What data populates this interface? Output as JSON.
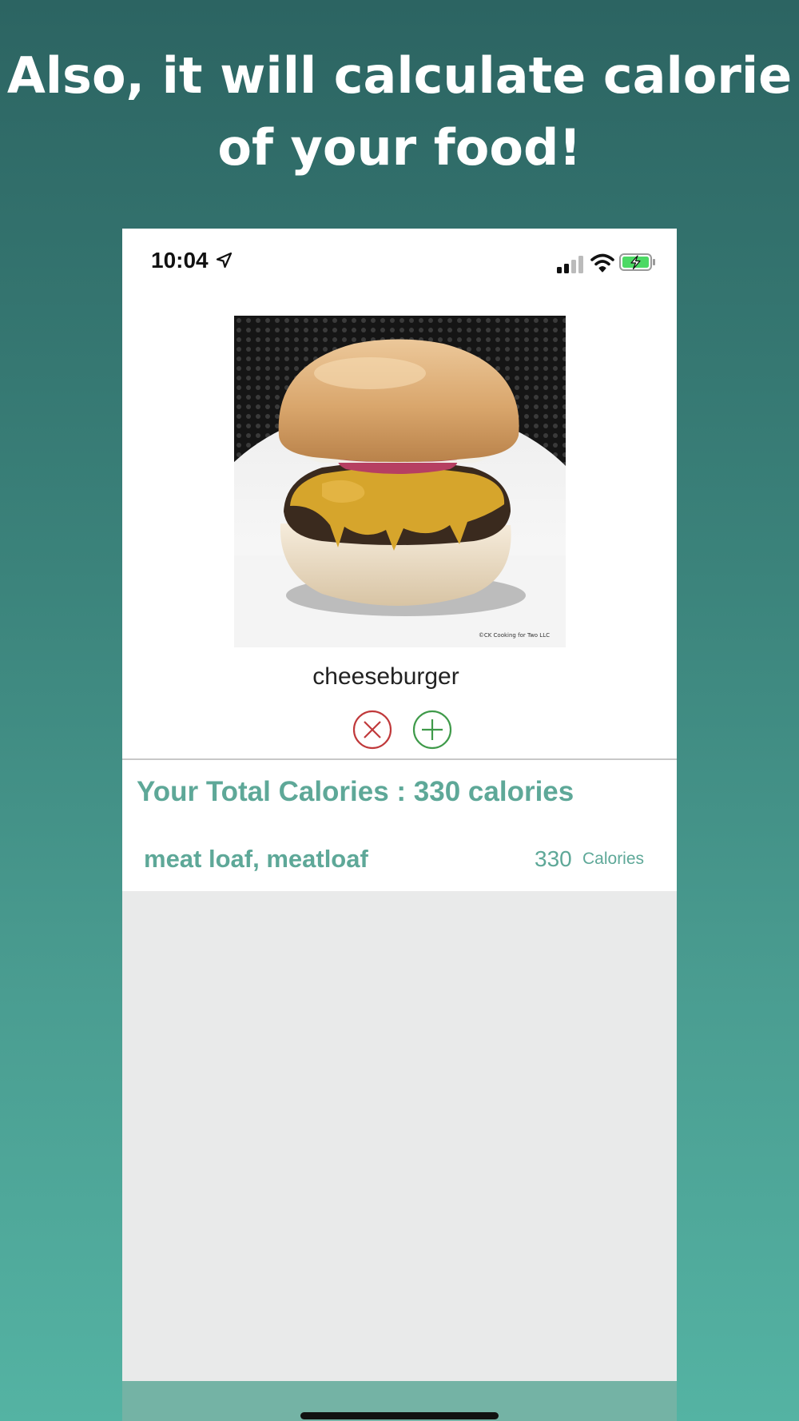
{
  "headline": "Also, it will calculate calorie of your food!",
  "status_bar": {
    "time": "10:04",
    "location_icon": "location-arrow-icon",
    "signal_icon": "cellular-signal-icon",
    "wifi_icon": "wifi-icon",
    "battery_icon": "battery-charging-icon"
  },
  "recognition": {
    "photo_icon": "cheeseburger-photo",
    "label": "cheeseburger",
    "reject_icon": "close-circle-icon",
    "accept_icon": "plus-circle-icon"
  },
  "summary": {
    "total_text": "Your Total Calories : 330 calories"
  },
  "entries": [
    {
      "name": "meat loaf, meatloaf",
      "calories": "330",
      "unit": "Calories"
    }
  ],
  "colors": {
    "accent": "#5ea898",
    "reject": "#c0393b",
    "accept": "#3f9a4a",
    "panel_background": "#e9eaea",
    "bottom_bar": "#74b3a5"
  }
}
